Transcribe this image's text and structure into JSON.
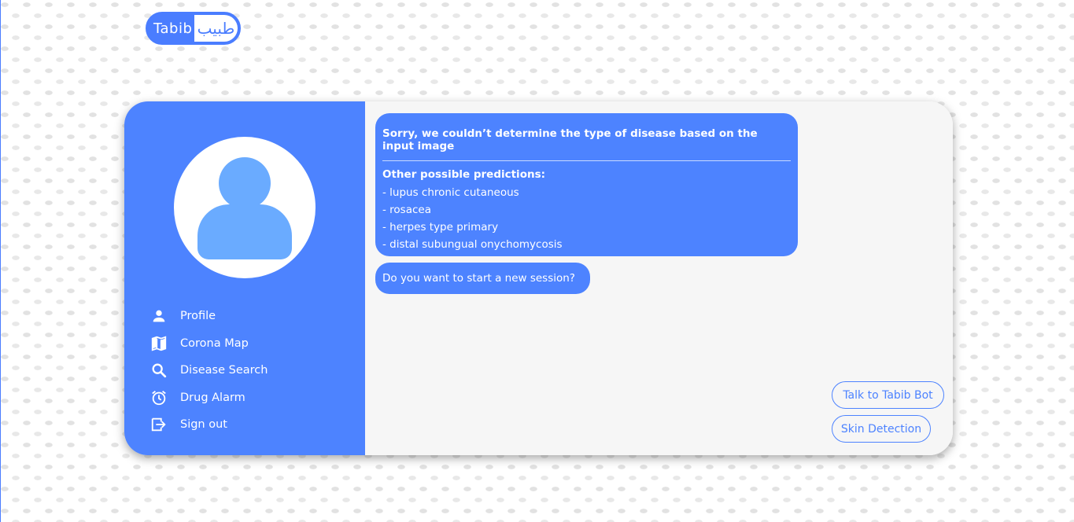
{
  "logo": {
    "english": "Tabib",
    "arabic": "طبيب"
  },
  "sidebar": {
    "items": [
      {
        "label": "Profile",
        "icon": "person-icon"
      },
      {
        "label": "Corona Map",
        "icon": "map-icon"
      },
      {
        "label": "Disease Search",
        "icon": "search-icon"
      },
      {
        "label": "Drug Alarm",
        "icon": "alarm-icon"
      },
      {
        "label": "Sign out",
        "icon": "sign-out-icon"
      }
    ]
  },
  "chat": {
    "message1": {
      "title": "Sorry, we couldn’t determine the type of disease based on the input image",
      "subtitle": "Other possible predictions:",
      "predictions": [
        "- lupus chronic cutaneous",
        "- rosacea",
        "- herpes type primary",
        "- distal subungual onychomycosis"
      ]
    },
    "message2": "Do you want to start a new session?"
  },
  "actions": {
    "talk_bot": "Talk to Tabib Bot",
    "skin_detection": "Skin Detection"
  },
  "colors": {
    "primary": "#4d83ff",
    "panel": "#f6f6f6",
    "avatar": "#6aabff"
  }
}
